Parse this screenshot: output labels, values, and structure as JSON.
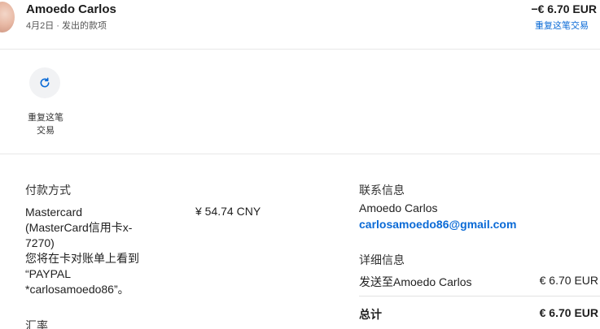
{
  "header": {
    "merchant_name": "Amoedo Carlos",
    "subtitle": "4月2日 · 发出的款项",
    "amount": "−€ 6.70 EUR",
    "repeat_link": "重复这笔交易"
  },
  "action": {
    "icon": "refresh-icon",
    "label_line1": "重复这笔",
    "label_line2": "交易"
  },
  "payment": {
    "title": "付款方式",
    "lines": [
      "Mastercard",
      "(MasterCard信用卡x-",
      "7270)",
      "您将在卡对账单上看到",
      "“PAYPAL",
      "*carlosamoedo86”。"
    ],
    "amount": "¥ 54.74 CNY"
  },
  "exchange": {
    "title": "汇率"
  },
  "contact": {
    "title": "联系信息",
    "name": "Amoedo Carlos",
    "email": "carlosamoedo86@gmail.com"
  },
  "details": {
    "title": "详细信息",
    "row_label": "发送至Amoedo Carlos",
    "row_value": "€ 6.70 EUR",
    "total_label": "总计",
    "total_value": "€ 6.70 EUR"
  },
  "colors": {
    "link": "#0a6ad6",
    "divider": "#e8e8e8",
    "button_bg": "#f1f2f4"
  }
}
